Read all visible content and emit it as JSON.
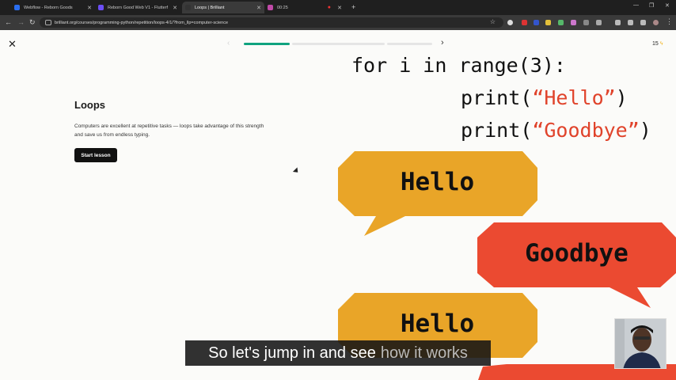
{
  "browser": {
    "tabs": [
      {
        "label": "Webflow - Reborn Goods",
        "color": "#2a6ef0"
      },
      {
        "label": "Reborn Good Web V1 - Flutterf",
        "color": "#6c4ef5"
      },
      {
        "label": "Loops | Brilliant",
        "color": "#333333"
      },
      {
        "label": "00:25",
        "color": "#c04aa8"
      }
    ],
    "url": "brilliant.org/courses/programming-python/repetition/loops-4/1/?from_llp=computer-science"
  },
  "lesson": {
    "progress": 0.25,
    "energy": "15",
    "title": "Loops",
    "description": "Computers are excellent at repetitive tasks — loops take advantage of this strength and save us from endless typing.",
    "start_label": "Start lesson"
  },
  "illustration": {
    "code_line1": "for i in range(3):",
    "code_print": "print(",
    "hello_str": "“Hello”",
    "goodbye_str": "“Goodbye”",
    "close_paren": ")",
    "bubble_hello": "Hello",
    "bubble_goodbye": "Goodbye",
    "colors": {
      "hello": "#e9a528",
      "goodbye": "#eb4a31"
    }
  },
  "subtitle": {
    "main": "So let's jump in and see",
    "faded": "how it works"
  }
}
